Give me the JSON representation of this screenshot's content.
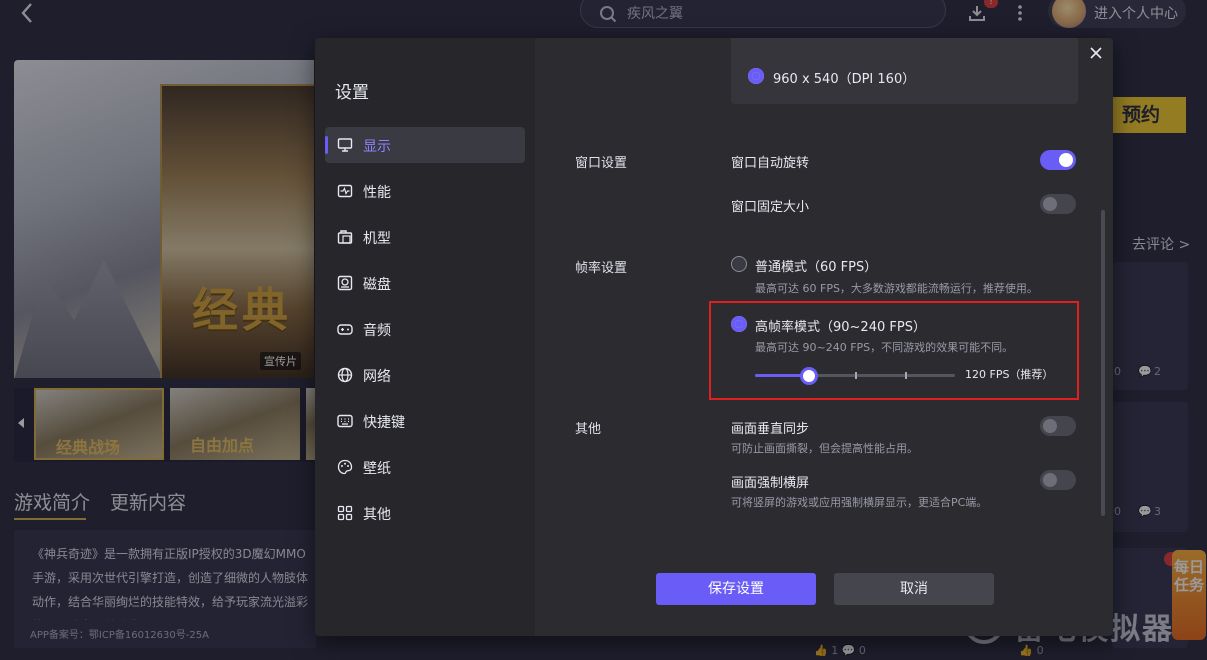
{
  "background": {
    "search": {
      "value": "疾风之翼"
    },
    "download_badge": "!",
    "user": {
      "label": "进入个人中心"
    },
    "hero": {
      "title": "经典",
      "tag": "宣传片"
    },
    "thumbnails": [
      "经典战场",
      "自由加点"
    ],
    "tabs": [
      "游戏简介",
      "更新内容"
    ],
    "description": "《神兵奇迹》是一款拥有正版IP授权的3D魔幻MMO手游，采用次世代引擎打造，创造了细微的人物肢体动作，结合华丽绚烂的技能特效，给予玩家流光溢彩的视觉盛宴。游戏背景则是",
    "icp": "APP备案号：鄂ICP备16012630号-25A",
    "reserve": "预约",
    "comment_link": "去评论 >",
    "card_stats": [
      {
        "likes": "0",
        "comments": "2"
      },
      {
        "likes": "0",
        "comments": "3"
      }
    ],
    "bottom_stats": {
      "likes": "1",
      "comments": "0",
      "likes2": "0"
    },
    "float_badge": "每日任务",
    "watermark": "雷电模拟器"
  },
  "modal": {
    "title": "设置",
    "nav": [
      {
        "label": "显示",
        "icon": "monitor-icon",
        "active": true
      },
      {
        "label": "性能",
        "icon": "performance-icon"
      },
      {
        "label": "机型",
        "icon": "phone-model-icon"
      },
      {
        "label": "磁盘",
        "icon": "disk-icon"
      },
      {
        "label": "音频",
        "icon": "audio-icon"
      },
      {
        "label": "网络",
        "icon": "network-icon"
      },
      {
        "label": "快捷键",
        "icon": "keyboard-icon"
      },
      {
        "label": "壁纸",
        "icon": "wallpaper-icon"
      },
      {
        "label": "其他",
        "icon": "other-icon"
      }
    ],
    "resolution": {
      "label": "960 x 540（DPI 160）",
      "selected": true
    },
    "window": {
      "section": "窗口设置",
      "auto_rotate": {
        "label": "窗口自动旋转",
        "on": true
      },
      "fixed_size": {
        "label": "窗口固定大小",
        "on": false
      }
    },
    "framerate": {
      "section": "帧率设置",
      "normal": {
        "label": "普通模式（60 FPS）",
        "sub": "最高可达 60 FPS，大多数游戏都能流畅运行，推荐使用。",
        "selected": false
      },
      "high": {
        "label": "高帧率模式（90~240 FPS）",
        "sub": "最高可达 90~240 FPS，不同游戏的效果可能不同。",
        "selected": true
      },
      "slider": {
        "value": 120,
        "min": 90,
        "max": 240,
        "ticks": [
          120,
          180,
          240
        ],
        "value_label": "120 FPS（推荐）"
      }
    },
    "other": {
      "section": "其他",
      "vsync": {
        "label": "画面垂直同步",
        "sub": "可防止画面撕裂，但会提高性能占用。",
        "on": false
      },
      "force_landscape": {
        "label": "画面强制横屏",
        "sub": "可将竖屏的游戏或应用强制横屏显示，更适合PC端。",
        "on": false
      }
    },
    "buttons": {
      "save": "保存设置",
      "cancel": "取消"
    }
  }
}
